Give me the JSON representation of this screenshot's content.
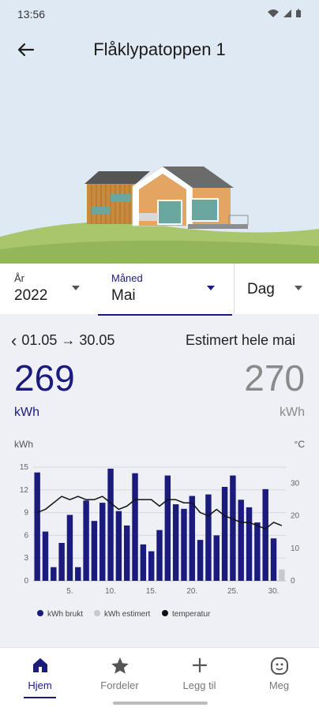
{
  "status": {
    "time": "13:56"
  },
  "header": {
    "title": "Flåklypatoppen 1"
  },
  "selector": {
    "year": {
      "label": "År",
      "value": "2022"
    },
    "month": {
      "label": "Måned",
      "value": "Mai"
    },
    "day": {
      "label": "Dag"
    }
  },
  "summary": {
    "period": "01.05 → 30.05",
    "estimate_label": "Estimert hele mai",
    "used_value": "269",
    "used_unit": "kWh",
    "estimate_value": "270",
    "estimate_unit": "kWh"
  },
  "chart_data": {
    "type": "bar",
    "ylabel_left": "kWh",
    "ylabel_right": "°C",
    "ylim_left": [
      0,
      15
    ],
    "ylim_right": [
      0,
      35
    ],
    "yticks_left": [
      0,
      3,
      6,
      9,
      12,
      15
    ],
    "yticks_right": [
      0,
      10,
      20,
      30
    ],
    "x": [
      1,
      2,
      3,
      4,
      5,
      6,
      7,
      8,
      9,
      10,
      11,
      12,
      13,
      14,
      15,
      16,
      17,
      18,
      19,
      20,
      21,
      22,
      23,
      24,
      25,
      26,
      27,
      28,
      29,
      30,
      31
    ],
    "xtick_labels": [
      "5.",
      "10.",
      "15.",
      "20.",
      "25.",
      "30."
    ],
    "series": [
      {
        "name": "kWh brukt",
        "color": "#1a1b7d",
        "values": [
          14.3,
          6.5,
          1.8,
          5.0,
          8.7,
          1.8,
          10.6,
          7.9,
          10.3,
          14.8,
          9.2,
          7.3,
          14.2,
          4.8,
          3.9,
          6.7,
          13.9,
          10.1,
          9.5,
          11.2,
          5.4,
          11.4,
          6.0,
          12.4,
          13.9,
          10.7,
          9.7,
          7.7,
          12.1,
          5.6,
          null
        ]
      },
      {
        "name": "kWh estimert",
        "color": "#c8c8cc",
        "values": [
          null,
          null,
          null,
          null,
          null,
          null,
          null,
          null,
          null,
          null,
          null,
          null,
          null,
          null,
          null,
          null,
          null,
          null,
          null,
          null,
          null,
          null,
          null,
          null,
          null,
          null,
          null,
          null,
          null,
          null,
          1.5
        ]
      },
      {
        "name": "temperatur",
        "color": "#111111",
        "values": [
          21,
          22,
          24,
          26,
          25,
          26,
          25,
          25,
          26,
          24,
          22,
          23,
          25,
          25,
          25,
          23,
          25,
          25,
          24,
          24,
          21,
          20,
          22,
          20,
          19,
          18,
          18,
          17,
          16,
          18,
          17
        ]
      }
    ],
    "legend": [
      "kWh brukt",
      "kWh estimert",
      "temperatur"
    ],
    "legend_placement": "bottom"
  },
  "nav": {
    "items": [
      {
        "label": "Hjem",
        "icon": "home-icon"
      },
      {
        "label": "Fordeler",
        "icon": "star-icon"
      },
      {
        "label": "Legg til",
        "icon": "plus-icon"
      },
      {
        "label": "Meg",
        "icon": "face-icon"
      }
    ]
  },
  "colors": {
    "accent": "#1a1b7d",
    "estimate": "#8a8a8a",
    "sky": "#dfe9f4",
    "grass": "#a9c66c"
  }
}
